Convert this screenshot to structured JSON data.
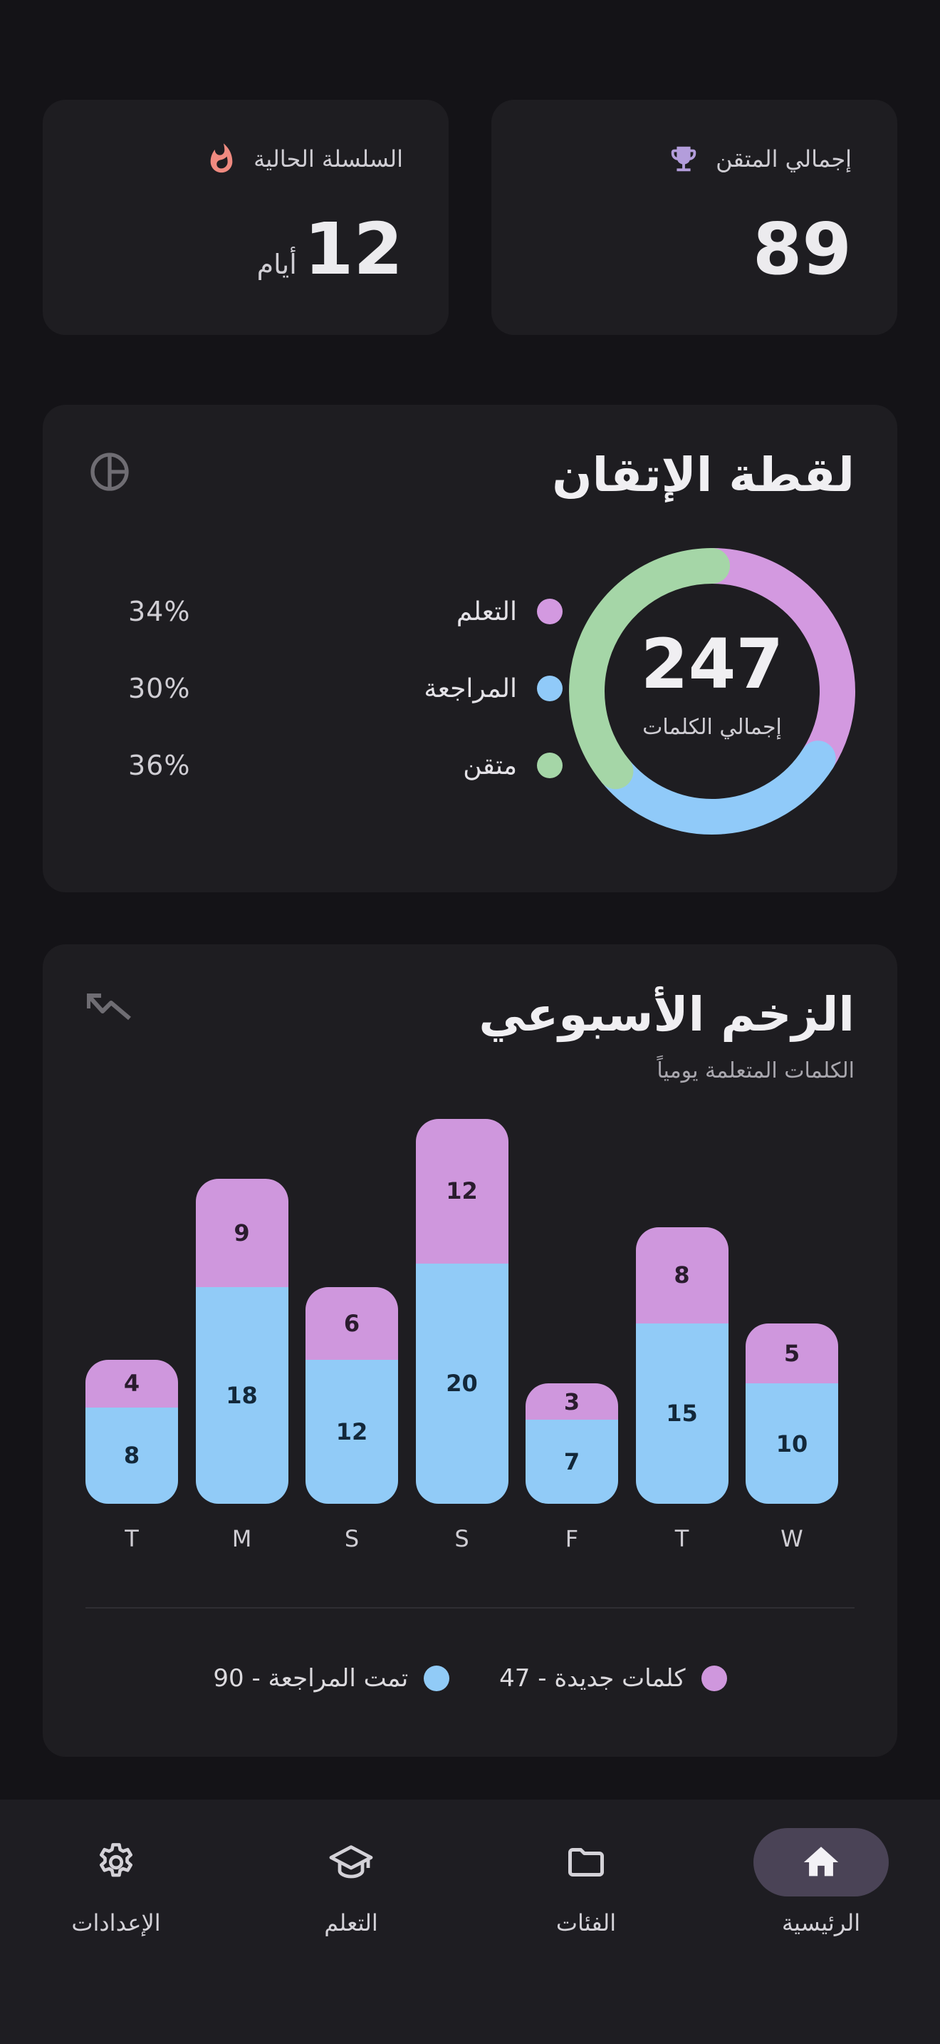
{
  "stats": {
    "total_mastered": {
      "label": "إجمالي المتقن",
      "value": "89"
    },
    "streak": {
      "label": "السلسلة الحالية",
      "value": "12",
      "unit": "أيام"
    }
  },
  "mastery": {
    "title": "لقطة الإتقان",
    "total": "247",
    "total_label": "إجمالي الكلمات",
    "items": [
      {
        "name": "التعلم",
        "pct": "34%",
        "color": "#d399e0"
      },
      {
        "name": "المراجعة",
        "pct": "30%",
        "color": "#90caf9"
      },
      {
        "name": "متقن",
        "pct": "36%",
        "color": "#a5d6a7"
      }
    ]
  },
  "weekly": {
    "title": "الزخم الأسبوعي",
    "subtitle": "الكلمات المتعلمة يومياً",
    "legend": {
      "new_words": "كلمات جديدة - 47",
      "reviewed": "تمت المراجعة - 90"
    }
  },
  "chart_data": {
    "type": "bar",
    "stacked": true,
    "categories": [
      "T",
      "M",
      "S",
      "S",
      "F",
      "T",
      "W"
    ],
    "series": [
      {
        "name": "تمت المراجعة",
        "values": [
          8,
          18,
          12,
          20,
          7,
          15,
          10
        ],
        "color": "#91cbf7"
      },
      {
        "name": "كلمات جديدة",
        "values": [
          4,
          9,
          6,
          12,
          3,
          8,
          5
        ],
        "color": "#cf97dd"
      }
    ],
    "title": "الزخم الأسبوعي",
    "ylim": [
      0,
      32
    ]
  },
  "nav": {
    "items": [
      {
        "label": "الرئيسية",
        "icon": "home-icon",
        "active": true
      },
      {
        "label": "الفئات",
        "icon": "folder-icon",
        "active": false
      },
      {
        "label": "التعلم",
        "icon": "school-icon",
        "active": false
      },
      {
        "label": "الإعدادات",
        "icon": "gear-icon",
        "active": false
      }
    ]
  }
}
